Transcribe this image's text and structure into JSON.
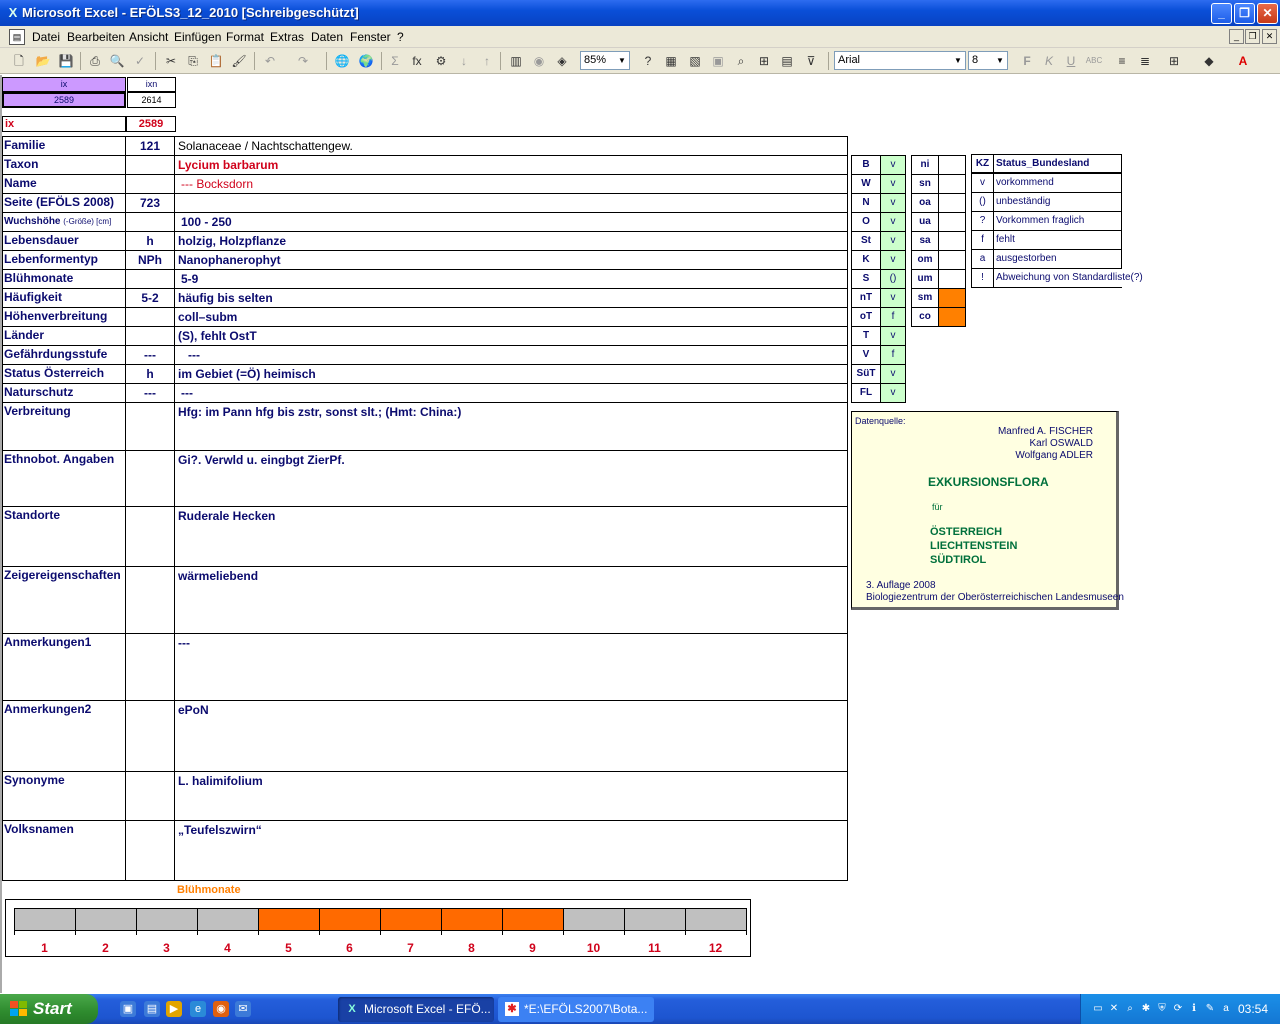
{
  "window": {
    "title": "Microsoft Excel - EFÖLS3_12_2010  [Schreibgeschützt]"
  },
  "menu": [
    "Datei",
    "Bearbeiten",
    "Ansicht",
    "Einfügen",
    "Format",
    "Extras",
    "Daten",
    "Fenster",
    "?"
  ],
  "toolbar": {
    "zoom": "85%",
    "font": "Arial",
    "size": "8"
  },
  "header": {
    "ix_label": "ix",
    "ixn_label": "ixn",
    "ix_value": "2589",
    "ixn_value": "2614",
    "ix_row_label": "ix",
    "ix_row_value": "2589"
  },
  "rows": [
    {
      "label": "Familie",
      "code": "121",
      "value": "Solanaceae  /  Nachtschattengew."
    },
    {
      "label": "Taxon",
      "code": "",
      "value": "Lycium barbarum"
    },
    {
      "label": "Name",
      "code": "",
      "value": "--- Bocksdorn"
    },
    {
      "label": "Seite (EFÖLS 2008)",
      "code": "723",
      "value": ""
    },
    {
      "label": "Wuchshöhe",
      "label_small": "(-Größe) [cm]",
      "code": "",
      "value": "100 - 250"
    },
    {
      "label": "Lebensdauer",
      "code": "h",
      "value": "holzig, Holzpflanze"
    },
    {
      "label": "Lebenformentyp",
      "code": "NPh",
      "value": "Nanophanerophyt"
    },
    {
      "label": "Blühmonate",
      "code": "",
      "value": "5-9"
    },
    {
      "label": "Häufigkeit",
      "code": "5-2",
      "value": "häufig bis selten"
    },
    {
      "label": "Höhenverbreitung",
      "code": "",
      "value": "coll–subm"
    },
    {
      "label": "Länder",
      "code": "",
      "value": "(S), fehlt OstT"
    },
    {
      "label": "Gefährdungsstufe",
      "code": "---",
      "value": "---"
    },
    {
      "label": "Status Österreich",
      "code": "h",
      "value": "im Gebiet (=Ö) heimisch"
    },
    {
      "label": "Naturschutz",
      "code": "---",
      "value": "---"
    },
    {
      "label": "Verbreitung",
      "code": "",
      "value": "Hfg:  im Pann hfg bis zstr, sonst slt.;  (Hmt: China:)"
    },
    {
      "label": "Ethnobot. Angaben",
      "code": "",
      "value": "Gi?. Verwld u. eingbgt ZierPf."
    },
    {
      "label": "Standorte",
      "code": "",
      "value": "Ruderale Hecken"
    },
    {
      "label": "Zeigereigenschaften",
      "code": "",
      "value": "wärmeliebend"
    },
    {
      "label": "Anmerkungen1",
      "code": "",
      "value": "---"
    },
    {
      "label": "Anmerkungen2",
      "code": "",
      "value": "ePoN"
    },
    {
      "label": "Synonyme",
      "code": "",
      "value": "L. halimifolium"
    },
    {
      "label": "Volksnamen",
      "code": "",
      "value": "„Teufelszwirn“"
    }
  ],
  "regions": [
    {
      "code": "B",
      "v": "v"
    },
    {
      "code": "W",
      "v": "v"
    },
    {
      "code": "N",
      "v": "v"
    },
    {
      "code": "O",
      "v": "v"
    },
    {
      "code": "St",
      "v": "v"
    },
    {
      "code": "K",
      "v": "v"
    },
    {
      "code": "S",
      "v": "()"
    },
    {
      "code": "nT",
      "v": "v"
    },
    {
      "code": "oT",
      "v": "f"
    },
    {
      "code": "T",
      "v": "v"
    },
    {
      "code": "V",
      "v": "f"
    },
    {
      "code": "SüT",
      "v": "v"
    },
    {
      "code": "FL",
      "v": "v"
    }
  ],
  "zones": [
    {
      "code": "ni",
      "v": ""
    },
    {
      "code": "sn",
      "v": ""
    },
    {
      "code": "oa",
      "v": ""
    },
    {
      "code": "ua",
      "v": ""
    },
    {
      "code": "sa",
      "v": ""
    },
    {
      "code": "om",
      "v": ""
    },
    {
      "code": "um",
      "v": ""
    },
    {
      "code": "sm",
      "v": "orange"
    },
    {
      "code": "co",
      "v": "orange"
    }
  ],
  "legend": {
    "head_kz": "KZ",
    "head_status": "Status_Bundesland",
    "items": [
      {
        "k": "v",
        "t": "vorkommend"
      },
      {
        "k": "()",
        "t": "unbeständig"
      },
      {
        "k": "?",
        "t": "Vorkommen fraglich"
      },
      {
        "k": "f",
        "t": "fehlt"
      },
      {
        "k": "a",
        "t": "ausgestorben"
      },
      {
        "k": "!",
        "t": "Abweichung von Standardliste(?)"
      }
    ]
  },
  "source": {
    "label": "Datenquelle:",
    "author1": "Manfred A. FISCHER",
    "author2": "Karl OSWALD",
    "author3": "Wolfgang ADLER",
    "title": "EXKURSIONSFLORA",
    "fuer": "für",
    "c1": "ÖSTERREICH",
    "c2": "LIECHTENSTEIN",
    "c3": "SÜDTIROL",
    "edition": "3. Auflage 2008",
    "publisher": "Biologiezentrum der Oberösterreichischen Landesmuseen"
  },
  "chart_data": {
    "type": "bar",
    "title": "Blühmonate",
    "categories": [
      "1",
      "2",
      "3",
      "4",
      "5",
      "6",
      "7",
      "8",
      "9",
      "10",
      "11",
      "12"
    ],
    "values": [
      0,
      0,
      0,
      0,
      1,
      1,
      1,
      1,
      1,
      0,
      0,
      0
    ],
    "colors": {
      "active": "#ff6a00",
      "inactive": "#c0c0c0"
    }
  },
  "taskbar": {
    "start": "Start",
    "task1": "Microsoft Excel - EFÖ...",
    "task2": "*E:\\EFÖLS2007\\Bota...",
    "clock": "03:54"
  }
}
